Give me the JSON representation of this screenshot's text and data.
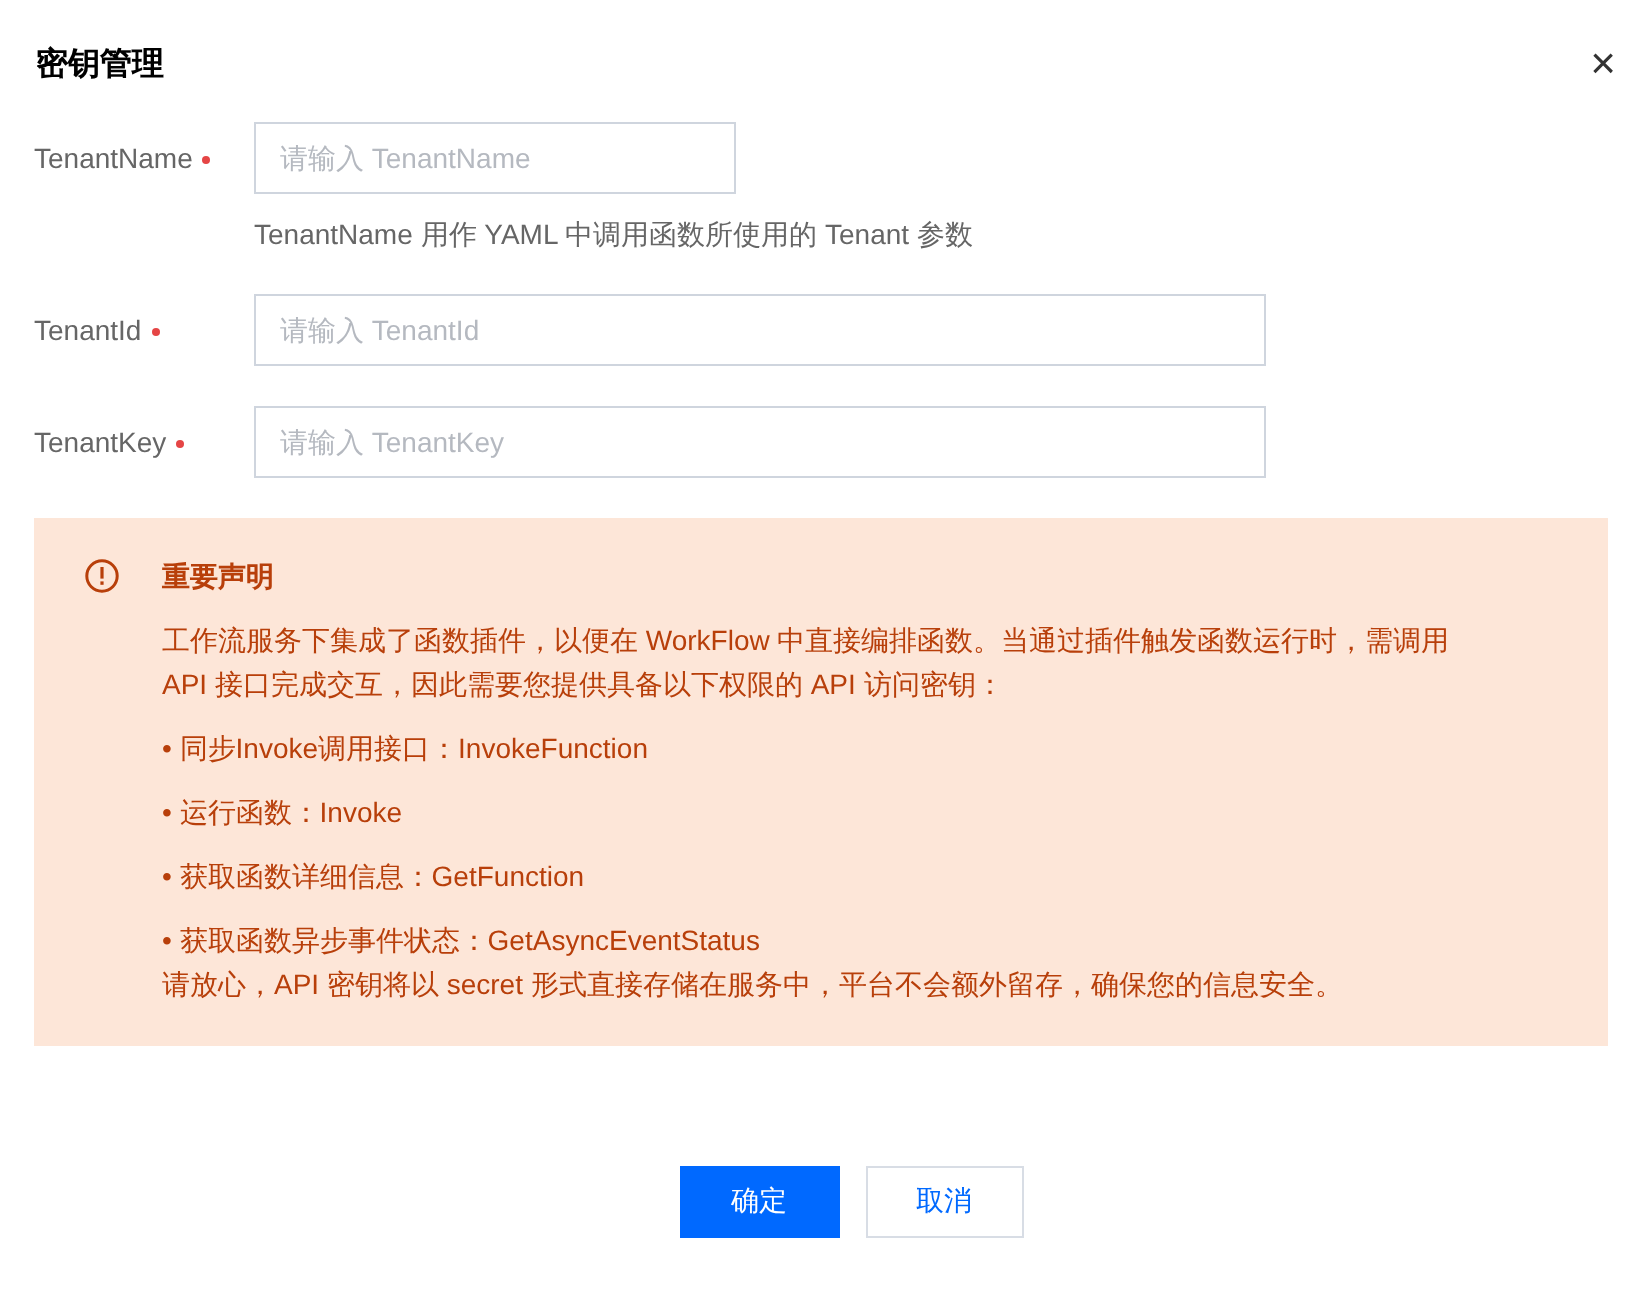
{
  "dialog": {
    "title": "密钥管理",
    "close_icon": "×"
  },
  "fields": [
    {
      "label": "TenantName",
      "required": true,
      "placeholder": "请输入 TenantName",
      "kind": "short",
      "hint": "TenantName 用作 YAML 中调用函数所使用的 Tenant 参数"
    },
    {
      "label": "TenantId",
      "required": true,
      "placeholder": "请输入 TenantId",
      "kind": "wide"
    },
    {
      "label": "TenantKey",
      "required": true,
      "placeholder": "请输入 TenantKey",
      "kind": "wide"
    }
  ],
  "notice": {
    "title": "重要声明",
    "body": "工作流服务下集成了函数插件，以便在 WorkFlow 中直接编排函数。当通过插件触发函数运行时，需调用\nAPI 接口完成交互，因此需要您提供具备以下权限的 API 访问密钥：",
    "items": [
      "• 同步Invoke调用接口：InvokeFunction",
      "• 运行函数：Invoke",
      "• 获取函数详细信息：GetFunction",
      "• 获取函数异步事件状态：GetAsyncEventStatus"
    ],
    "footer": "请放心，API 密钥将以 secret 形式直接存储在服务中，平台不会额外留存，确保您的信息安全。"
  },
  "buttons": [
    {
      "label": "确定",
      "kind": "primary"
    },
    {
      "label": "取消",
      "kind": "secondary"
    }
  ]
}
